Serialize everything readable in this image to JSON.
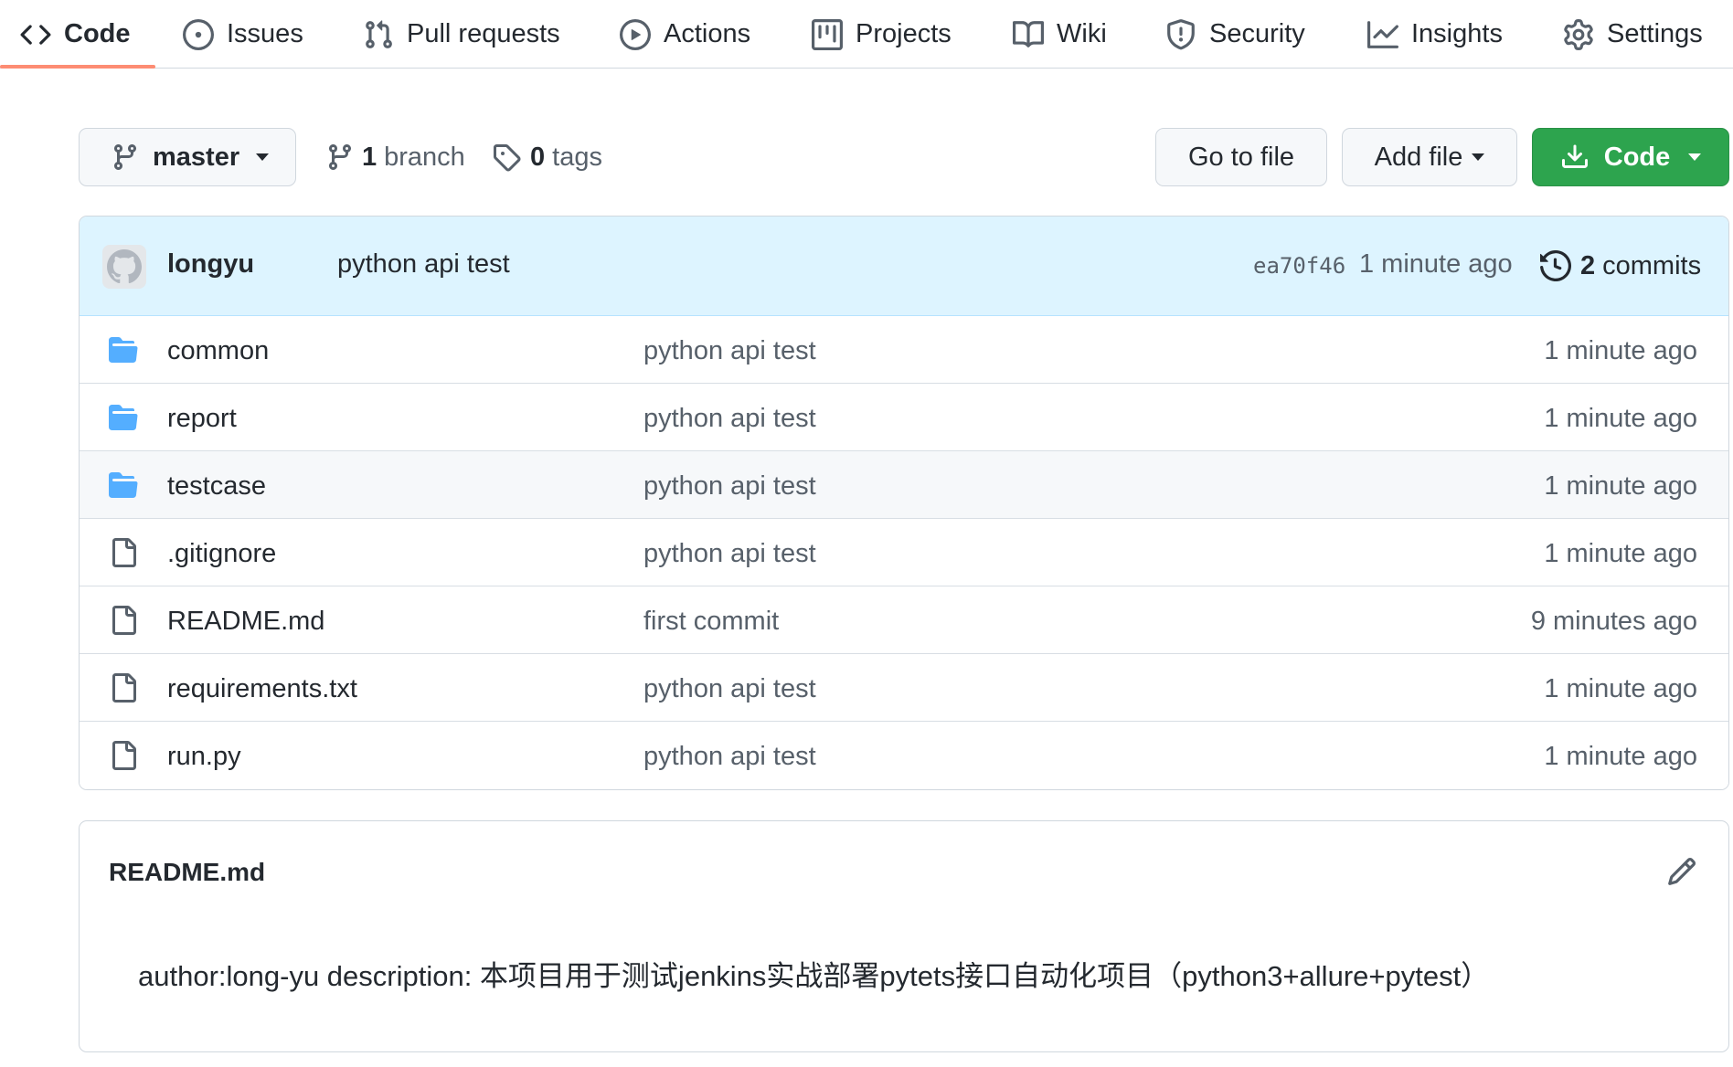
{
  "repo_nav": {
    "tabs": [
      {
        "label": "Code",
        "icon": "code-icon",
        "selected": true
      },
      {
        "label": "Issues",
        "icon": "issue-opened-icon"
      },
      {
        "label": "Pull requests",
        "icon": "git-pull-request-icon"
      },
      {
        "label": "Actions",
        "icon": "play-icon"
      },
      {
        "label": "Projects",
        "icon": "project-icon"
      },
      {
        "label": "Wiki",
        "icon": "book-icon"
      },
      {
        "label": "Security",
        "icon": "shield-icon"
      },
      {
        "label": "Insights",
        "icon": "graph-icon"
      },
      {
        "label": "Settings",
        "icon": "gear-icon"
      }
    ],
    "selected_underline_color": "#fd8c73"
  },
  "toolbar": {
    "branch_button": {
      "label": "master",
      "icon": "git-branch-icon"
    },
    "branches": {
      "count": "1",
      "label": "branch",
      "icon": "git-branch-icon"
    },
    "tags": {
      "count": "0",
      "label": "tags",
      "icon": "tag-icon"
    },
    "go_to_file": "Go to file",
    "add_file": "Add file",
    "code_button": {
      "label": "Code",
      "icon": "download-icon",
      "color": "#2da44e"
    }
  },
  "latest_commit": {
    "author": "longyu",
    "message": "python api test",
    "sha": "ea70f46",
    "time": "1 minute ago",
    "commit_count": "2",
    "commit_label": "commits",
    "header_bg": "#ddf4ff"
  },
  "files": [
    {
      "name": "common",
      "type": "folder",
      "message": "python api test",
      "age": "1 minute ago"
    },
    {
      "name": "report",
      "type": "folder",
      "message": "python api test",
      "age": "1 minute ago"
    },
    {
      "name": "testcase",
      "type": "folder",
      "message": "python api test",
      "age": "1 minute ago"
    },
    {
      "name": ".gitignore",
      "type": "file",
      "message": "python api test",
      "age": "1 minute ago"
    },
    {
      "name": "README.md",
      "type": "file",
      "message": "first commit",
      "age": "9 minutes ago"
    },
    {
      "name": "requirements.txt",
      "type": "file",
      "message": "python api test",
      "age": "1 minute ago"
    },
    {
      "name": "run.py",
      "type": "file",
      "message": "python api test",
      "age": "1 minute ago"
    }
  ],
  "folder_color": "#54aeff",
  "readme": {
    "title": "README.md",
    "body": "author:long-yu description: 本项目用于测试jenkins实战部署pytets接口自动化项目（python3+allure+pytest）"
  }
}
